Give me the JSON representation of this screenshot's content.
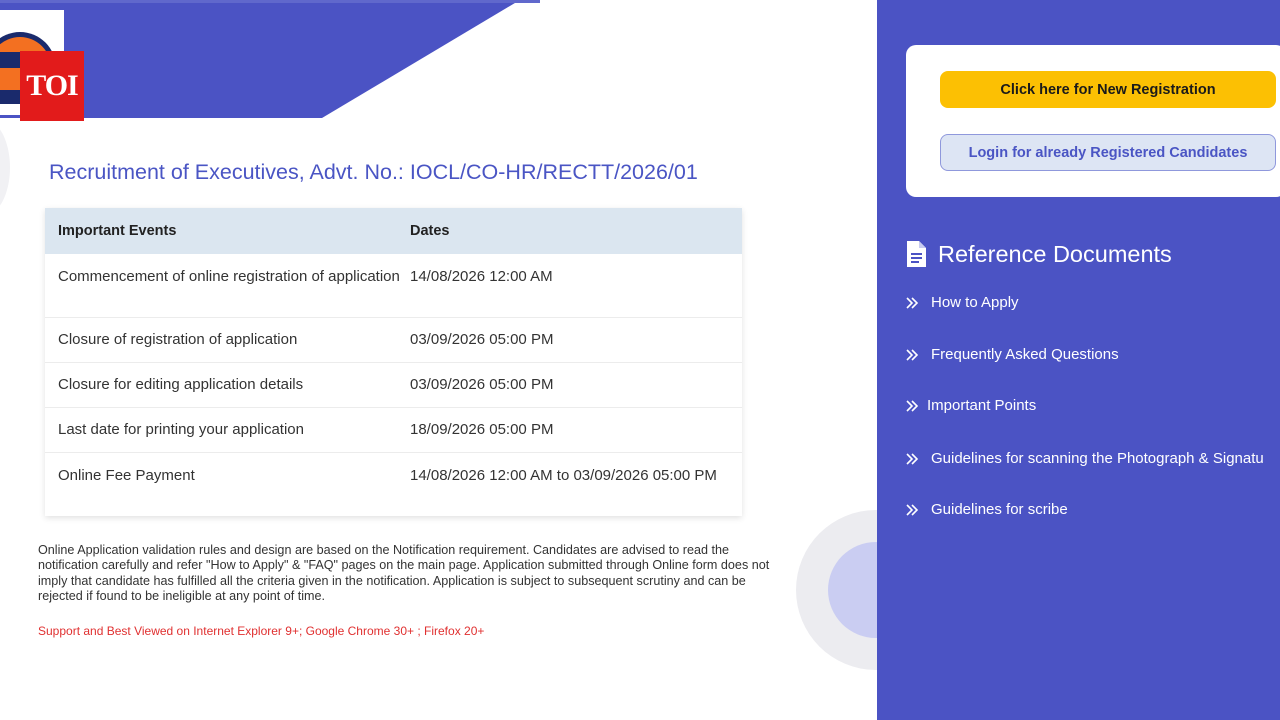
{
  "banner": {
    "logo_text": "TOI",
    "brand_color": "#4b53c4"
  },
  "page_title": "Recruitment of Executives, Advt. No.: IOCL/CO-HR/RECTT/2026/01",
  "events_table": {
    "headers": [
      "Important Events",
      "Dates"
    ],
    "rows": [
      {
        "event": "Commencement of online registration of application",
        "date": "14/08/2026 12:00 AM"
      },
      {
        "event": "Closure of registration of application",
        "date": "03/09/2026 05:00 PM"
      },
      {
        "event": "Closure for editing application details",
        "date": "03/09/2026 05:00 PM"
      },
      {
        "event": "Last date for printing your application",
        "date": "18/09/2026 05:00 PM"
      },
      {
        "event": "Online Fee Payment",
        "date": "14/08/2026 12:00 AM to 03/09/2026 05:00 PM"
      }
    ]
  },
  "note": "Online Application validation rules and design are based on the Notification requirement. Candidates are advised to read the notification carefully and refer \"How to Apply\" & \"FAQ\" pages on the main page. Application submitted through Online form does not imply that candidate has fulfilled all the criteria given in the notification. Application is subject to subsequent scrutiny and can be rejected if found to be ineligible at any point of time.",
  "support_text": "Support and Best Viewed on Internet Explorer 9+; Google Chrome 30+ ; Firefox 20+",
  "actions": {
    "new_registration": "Click here for New Registration",
    "login": "Login for already Registered Candidates"
  },
  "reference": {
    "title": "Reference Documents",
    "icon": "document-icon",
    "items": [
      "How to Apply",
      "Frequently Asked Questions",
      "Important Points",
      "Guidelines for scanning the Photograph & Signatu",
      "Guidelines for scribe"
    ]
  },
  "colors": {
    "accent_yellow": "#fcc003",
    "title_blue": "#4a55c4",
    "support_red": "#e03030"
  }
}
